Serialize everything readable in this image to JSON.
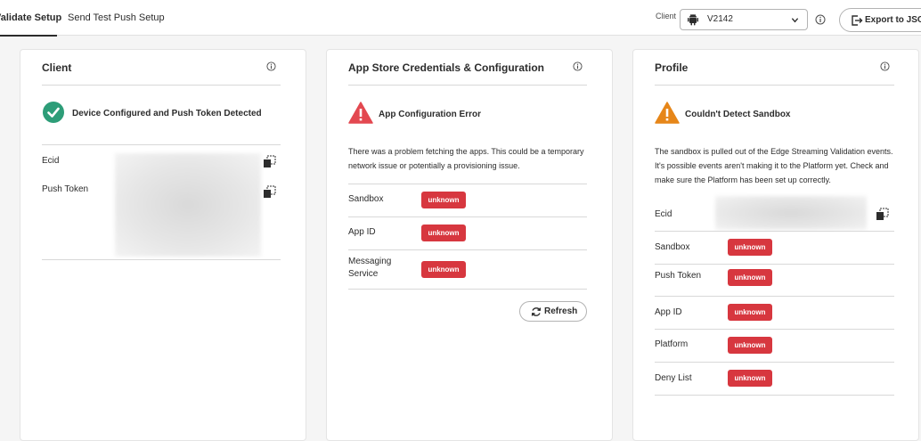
{
  "tabs": [
    {
      "label": "Validate Setup",
      "active": true
    },
    {
      "label": "Send Test Push Setup",
      "active": false
    }
  ],
  "toolbar": {
    "client_label": "Client",
    "client_value": "V2142",
    "client_icon": "android-icon",
    "export_label": "Export to JSON"
  },
  "colors": {
    "accent_success": "#2d9d78",
    "accent_warning": "#e68619",
    "accent_error": "#e34850",
    "badge_bg": "#d7373f"
  },
  "client_card": {
    "title": "Client",
    "status": {
      "icon": "check-circle-icon",
      "text": "Device Configured and Push Token Detected"
    },
    "rows": [
      {
        "label": "Ecid"
      },
      {
        "label": "Push Token"
      }
    ]
  },
  "appstore_card": {
    "title": "App Store Credentials & Configuration",
    "status": {
      "icon": "alert-triangle-icon",
      "text": "App Configuration Error"
    },
    "description": "There was a problem fetching the apps. This could be a temporary network issue or potentially a provisioning issue.",
    "rows": [
      {
        "label": "Sandbox",
        "value": "unknown"
      },
      {
        "label": "App ID",
        "value": "unknown"
      },
      {
        "label": "Messaging Service",
        "value": "unknown"
      }
    ],
    "refresh_label": "Refresh"
  },
  "profile_card": {
    "title": "Profile",
    "status": {
      "icon": "alert-triangle-icon",
      "text": "Couldn't Detect Sandbox"
    },
    "description": "The sandbox is pulled out of the Edge Streaming Validation events. It's possible events aren't making it to the Platform yet. Check and make sure the Platform has been set up correctly.",
    "rows": [
      {
        "label": "Ecid"
      },
      {
        "label": "Sandbox",
        "value": "unknown"
      },
      {
        "label": "Push Token",
        "value": "unknown"
      },
      {
        "label": "App ID",
        "value": "unknown"
      },
      {
        "label": "Platform",
        "value": "unknown"
      },
      {
        "label": "Deny List",
        "value": "unknown"
      }
    ]
  }
}
